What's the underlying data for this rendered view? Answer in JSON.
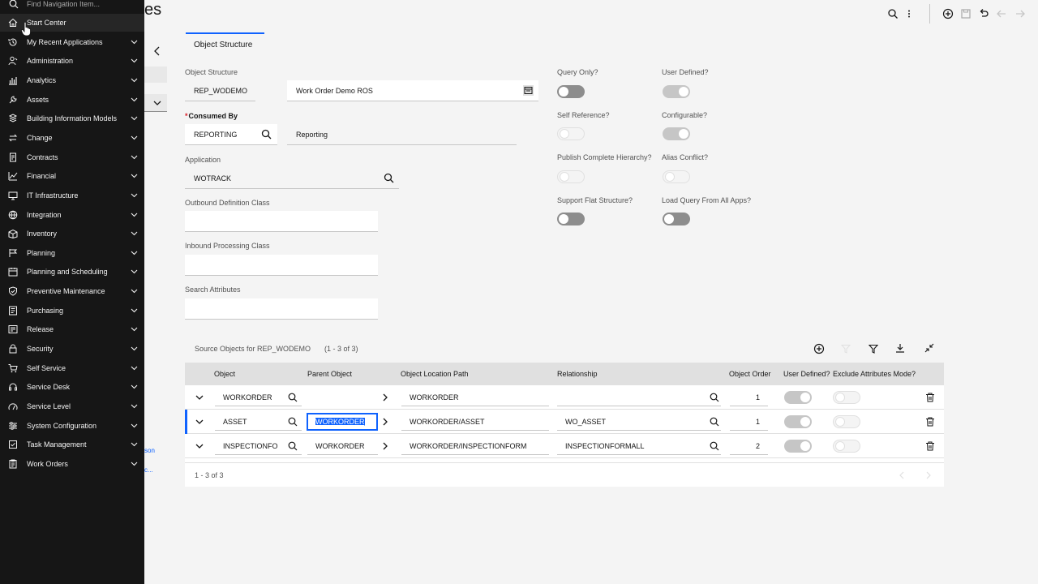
{
  "nav": {
    "search_placeholder": "Find Navigation Item...",
    "items": [
      {
        "label": "Start Center",
        "icon": "home-icon",
        "chevron": false
      },
      {
        "label": "My Recent Applications",
        "icon": "recent-icon",
        "chevron": true
      },
      {
        "label": "Administration",
        "icon": "user-admin-icon",
        "chevron": true
      },
      {
        "label": "Analytics",
        "icon": "analytics-icon",
        "chevron": true
      },
      {
        "label": "Assets",
        "icon": "assets-icon",
        "chevron": true
      },
      {
        "label": "Building Information Models",
        "icon": "building-icon",
        "chevron": true
      },
      {
        "label": "Change",
        "icon": "change-icon",
        "chevron": true
      },
      {
        "label": "Contracts",
        "icon": "contracts-icon",
        "chevron": true
      },
      {
        "label": "Financial",
        "icon": "financial-icon",
        "chevron": true
      },
      {
        "label": "IT Infrastructure",
        "icon": "it-infrastructure-icon",
        "chevron": true
      },
      {
        "label": "Integration",
        "icon": "integration-icon",
        "chevron": true
      },
      {
        "label": "Inventory",
        "icon": "inventory-icon",
        "chevron": true
      },
      {
        "label": "Planning",
        "icon": "planning-icon",
        "chevron": true
      },
      {
        "label": "Planning and Scheduling",
        "icon": "scheduling-icon",
        "chevron": true
      },
      {
        "label": "Preventive Maintenance",
        "icon": "preventive-icon",
        "chevron": true
      },
      {
        "label": "Purchasing",
        "icon": "purchasing-icon",
        "chevron": true
      },
      {
        "label": "Release",
        "icon": "release-icon",
        "chevron": true
      },
      {
        "label": "Security",
        "icon": "lock-icon",
        "chevron": true
      },
      {
        "label": "Self Service",
        "icon": "cart-icon",
        "chevron": true
      },
      {
        "label": "Service Desk",
        "icon": "service-desk-icon",
        "chevron": true
      },
      {
        "label": "Service Level",
        "icon": "service-level-icon",
        "chevron": true
      },
      {
        "label": "System Configuration",
        "icon": "sliders-icon",
        "chevron": true
      },
      {
        "label": "Task Management",
        "icon": "task-icon",
        "chevron": true
      },
      {
        "label": "Work Orders",
        "icon": "work-orders-icon",
        "chevron": true
      }
    ]
  },
  "background": {
    "title_fragment": "es",
    "link1": "son",
    "link2": "c..."
  },
  "tab": {
    "label": "Object Structure"
  },
  "form": {
    "object_structure": {
      "label": "Object Structure",
      "value": "REP_WODEMO",
      "description": "Work Order Demo ROS"
    },
    "consumed_by": {
      "required_mark": "*",
      "label": "Consumed By",
      "value": "REPORTING",
      "description": "Reporting"
    },
    "application": {
      "label": "Application",
      "value": "WOTRACK"
    },
    "outbound": {
      "label": "Outbound Definition Class",
      "value": ""
    },
    "inbound": {
      "label": "Inbound Processing Class",
      "value": ""
    },
    "search_attrs": {
      "label": "Search Attributes",
      "value": ""
    },
    "toggles": {
      "query_only": "Query Only?",
      "user_defined": "User Defined?",
      "self_reference": "Self Reference?",
      "configurable": "Configurable?",
      "publish_hierarchy": "Publish Complete Hierarchy?",
      "alias_conflict": "Alias Conflict?",
      "flat_structure": "Support Flat Structure?",
      "load_query": "Load Query From All Apps?"
    }
  },
  "table": {
    "title": "Source Objects for REP_WODEMO",
    "count": "(1 - 3 of 3)",
    "columns": [
      "Object",
      "Parent Object",
      "Object Location Path",
      "Relationship",
      "Object Order",
      "User Defined?",
      "Exclude Attributes Mode?"
    ],
    "rows": [
      {
        "object": "WORKORDER",
        "parent": "",
        "path": "WORKORDER",
        "relationship": "",
        "order": "1"
      },
      {
        "object": "ASSET",
        "parent": "WORKORDER",
        "path": "WORKORDER/ASSET",
        "relationship": "WO_ASSET",
        "order": "1"
      },
      {
        "object": "INSPECTIONFO",
        "parent": "WORKORDER",
        "path": "WORKORDER/INSPECTIONFORM",
        "relationship": "INSPECTIONFORMALL",
        "order": "2"
      }
    ],
    "footer": "1 - 3 of 3"
  },
  "colors": {
    "accent": "#0f62fe",
    "nav_bg": "#161616",
    "required": "#da1e28"
  }
}
